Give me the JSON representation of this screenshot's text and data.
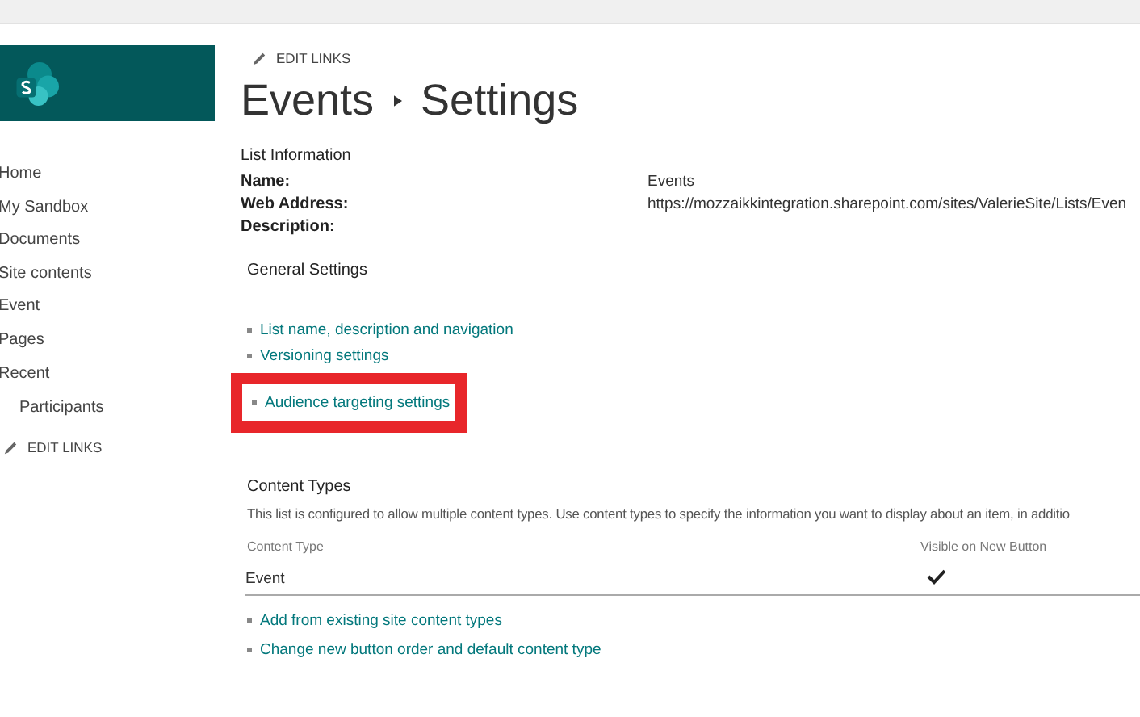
{
  "top_nav": {
    "edit_links": "EDIT LINKS"
  },
  "sidebar": {
    "items": [
      {
        "label": "Home"
      },
      {
        "label": "My Sandbox"
      },
      {
        "label": "Documents"
      },
      {
        "label": "Site contents"
      },
      {
        "label": "Event"
      },
      {
        "label": "Pages"
      },
      {
        "label": "Recent",
        "children": [
          {
            "label": "Participants"
          }
        ]
      }
    ],
    "edit_links": "EDIT LINKS"
  },
  "breadcrumb": [
    "Events",
    "Settings"
  ],
  "list_information": {
    "title": "List Information",
    "fields": [
      {
        "label": "Name:",
        "value": "Events"
      },
      {
        "label": "Web Address:",
        "value": "https://mozzaikkintegration.sharepoint.com/sites/ValerieSite/Lists/Even"
      },
      {
        "label": "Description:"
      }
    ]
  },
  "general_settings": {
    "title": "General Settings",
    "links": [
      {
        "label": "List name, description and navigation",
        "highlighted": false
      },
      {
        "label": "Versioning settings",
        "highlighted": false
      },
      {
        "label": "Audience targeting settings",
        "highlighted": true
      }
    ]
  },
  "content_types": {
    "title": "Content Types",
    "description": "This list is configured to allow multiple content types. Use content types to specify the information you want to display about an item, in additio",
    "columns": [
      "Content Type",
      "Visible on New Button"
    ],
    "rows": [
      {
        "name": "Event",
        "visible": true
      }
    ],
    "links": [
      "Add from existing site content types",
      "Change new button order and default content type"
    ]
  }
}
